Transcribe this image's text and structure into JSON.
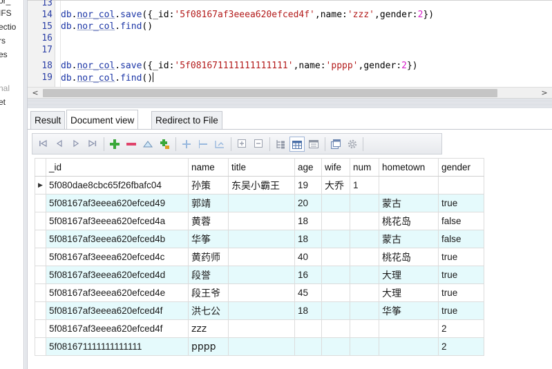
{
  "tree": {
    "items": [
      "or_",
      "IFS",
      "ectio",
      "rs",
      "es",
      "nal",
      "et"
    ]
  },
  "editor": {
    "lines": [
      {
        "num": "13",
        "segments": []
      },
      {
        "num": "14",
        "segments": [
          {
            "t": "db",
            "c": "c-obj"
          },
          {
            "t": ".",
            "c": "c-punc"
          },
          {
            "t": "nor_col",
            "c": "c-obj c-ul"
          },
          {
            "t": ".",
            "c": "c-punc"
          },
          {
            "t": "save",
            "c": "c-obj"
          },
          {
            "t": "({",
            "c": "c-punc"
          },
          {
            "t": "_id",
            "c": "c-key"
          },
          {
            "t": ":",
            "c": "c-punc"
          },
          {
            "t": "'5f08167af3eeea620efced4f'",
            "c": "c-str"
          },
          {
            "t": ",",
            "c": "c-punc"
          },
          {
            "t": "name",
            "c": "c-key"
          },
          {
            "t": ":",
            "c": "c-punc"
          },
          {
            "t": "'zzz'",
            "c": "c-str"
          },
          {
            "t": ",",
            "c": "c-punc"
          },
          {
            "t": "gender",
            "c": "c-key"
          },
          {
            "t": ":",
            "c": "c-punc"
          },
          {
            "t": "2",
            "c": "c-num"
          },
          {
            "t": "})",
            "c": "c-punc"
          }
        ]
      },
      {
        "num": "15",
        "segments": [
          {
            "t": "db",
            "c": "c-obj"
          },
          {
            "t": ".",
            "c": "c-punc"
          },
          {
            "t": "nor_col",
            "c": "c-obj c-ul"
          },
          {
            "t": ".",
            "c": "c-punc"
          },
          {
            "t": "find",
            "c": "c-obj"
          },
          {
            "t": "()",
            "c": "c-punc"
          }
        ]
      },
      {
        "num": "16",
        "segments": []
      },
      {
        "num": "17",
        "segments": []
      },
      {
        "num": "18",
        "segments": [
          {
            "t": "db",
            "c": "c-obj"
          },
          {
            "t": ".",
            "c": "c-punc"
          },
          {
            "t": "nor_col",
            "c": "c-obj c-ul"
          },
          {
            "t": ".",
            "c": "c-punc"
          },
          {
            "t": "save",
            "c": "c-obj"
          },
          {
            "t": "({",
            "c": "c-punc"
          },
          {
            "t": "_id",
            "c": "c-key"
          },
          {
            "t": ":",
            "c": "c-punc"
          },
          {
            "t": "'5f081671111111111111'",
            "c": "c-str"
          },
          {
            "t": ",",
            "c": "c-punc"
          },
          {
            "t": "name",
            "c": "c-key"
          },
          {
            "t": ":",
            "c": "c-punc"
          },
          {
            "t": "'pppp'",
            "c": "c-str"
          },
          {
            "t": ",",
            "c": "c-punc"
          },
          {
            "t": "gender",
            "c": "c-key"
          },
          {
            "t": ":",
            "c": "c-punc"
          },
          {
            "t": "2",
            "c": "c-num"
          },
          {
            "t": "})",
            "c": "c-punc"
          }
        ]
      },
      {
        "num": "19",
        "segments": [
          {
            "t": "db",
            "c": "c-obj"
          },
          {
            "t": ".",
            "c": "c-punc"
          },
          {
            "t": "nor_col",
            "c": "c-obj c-ul"
          },
          {
            "t": ".",
            "c": "c-punc"
          },
          {
            "t": "find",
            "c": "c-obj"
          },
          {
            "t": "()",
            "c": "c-punc"
          }
        ],
        "caret": true
      }
    ]
  },
  "scroll": {
    "left_arrow": "<",
    "right_arrow": ">"
  },
  "tabs": [
    {
      "label": "Result",
      "active": false
    },
    {
      "label": "Document view",
      "active": true
    },
    {
      "label": "Redirect to File",
      "active": false
    }
  ],
  "toolbar": {
    "icons": [
      "first-record-icon",
      "prev-record-icon",
      "next-record-icon",
      "last-record-icon",
      "add-document-icon",
      "delete-document-icon",
      "move-up-icon",
      "insert-field-icon",
      "add-field-icon",
      "remove-field-icon",
      "rename-field-icon",
      "expand-all-icon",
      "collapse-all-icon",
      "tree-view-icon",
      "grid-view-icon",
      "text-view-icon",
      "export-icon",
      "settings-icon"
    ]
  },
  "grid": {
    "columns": [
      "_id",
      "name",
      "title",
      "age",
      "wife",
      "num",
      "hometown",
      "gender"
    ],
    "current_row_marker": "▶",
    "rows": [
      [
        "5f080dae8cbc65f26fbafc04",
        "孙策",
        "东吴小霸王",
        "19",
        "大乔",
        "1",
        "",
        ""
      ],
      [
        "5f08167af3eeea620efced49",
        "郭靖",
        "",
        "20",
        "",
        "",
        "蒙古",
        "true"
      ],
      [
        "5f08167af3eeea620efced4a",
        "黄蓉",
        "",
        "18",
        "",
        "",
        "桃花岛",
        "false"
      ],
      [
        "5f08167af3eeea620efced4b",
        "华筝",
        "",
        "18",
        "",
        "",
        "蒙古",
        "false"
      ],
      [
        "5f08167af3eeea620efced4c",
        "黄药师",
        "",
        "40",
        "",
        "",
        "桃花岛",
        "true"
      ],
      [
        "5f08167af3eeea620efced4d",
        "段誉",
        "",
        "16",
        "",
        "",
        "大理",
        "true"
      ],
      [
        "5f08167af3eeea620efced4e",
        "段王爷",
        "",
        "45",
        "",
        "",
        "大理",
        "true"
      ],
      [
        "5f08167af3eeea620efced4f",
        "洪七公",
        "",
        "18",
        "",
        "",
        "华筝",
        "true"
      ],
      [
        "5f08167af3eeea620efced4f",
        "zzz",
        "",
        "",
        "",
        "",
        "",
        "2"
      ],
      [
        "5f081671111111111111",
        "pppp",
        "",
        "",
        "",
        "",
        "",
        "2"
      ]
    ]
  },
  "colors": {
    "alt_row": "#e5fafc",
    "code_object": "#1b35a6",
    "code_string": "#b31a1a",
    "code_number": "#d81fc9",
    "gutter_number": "#2b3fa6"
  }
}
